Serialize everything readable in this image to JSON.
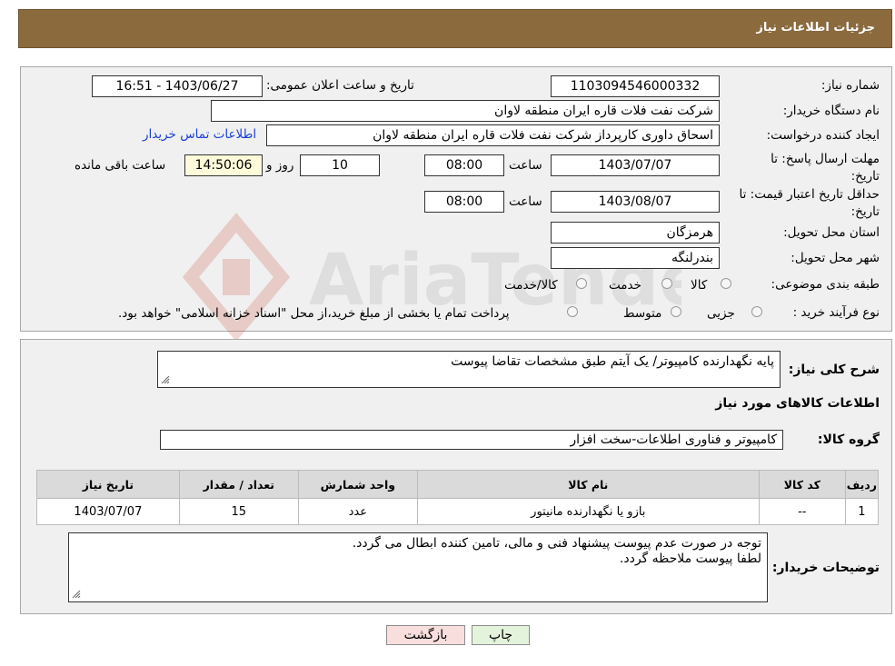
{
  "header": {
    "title": "جزئیات اطلاعات نیاز"
  },
  "form": {
    "need_number_label": "شماره نیاز:",
    "need_number": "1103094546000332",
    "announce_label": "تاریخ و ساعت اعلان عمومی:",
    "announce_value": "1403/06/27 - 16:51",
    "buyer_org_label": "نام دستگاه خریدار:",
    "buyer_org": "شرکت نفت فلات قاره ایران منطقه لاوان",
    "creator_label": "ایجاد کننده درخواست:",
    "creator": "اسحاق داوری کارپرداز شرکت نفت فلات قاره ایران منطقه لاوان",
    "contact_link": "اطلاعات تماس خریدار",
    "deadline_label": "مهلت ارسال پاسخ: تا تاریخ:",
    "deadline_date": "1403/07/07",
    "time_label": "ساعت",
    "deadline_time": "08:00",
    "days_value": "10",
    "days_label": "روز و",
    "remaining_time": "14:50:06",
    "remaining_label": "ساعت باقی مانده",
    "validity_label": "حداقل تاریخ اعتبار قیمت: تا تاریخ:",
    "validity_date": "1403/08/07",
    "validity_time": "08:00",
    "province_label": "استان محل تحویل:",
    "province": "هرمزگان",
    "city_label": "شهر محل تحویل:",
    "city": "بندرلنگه",
    "category_label": "طبقه بندی موضوعی:",
    "category_options": [
      "کالا",
      "خدمت",
      "کالا/خدمت"
    ],
    "process_label": "نوع فرآیند خرید :",
    "process_options": [
      "جزیی",
      "متوسط"
    ],
    "process_note": "پرداخت تمام یا بخشی از مبلغ خرید،از محل \"اسناد خزانه اسلامی\" خواهد بود."
  },
  "watermark": {
    "text": "AriaTender.neT"
  },
  "details": {
    "summary_label": "شرح کلی نیاز:",
    "summary": "پایه نگهدارنده کامپیوتر/ یک آیتم طبق مشخصات تقاضا پیوست",
    "goods_info_title": "اطلاعات کالاهای مورد نیاز",
    "goods_group_label": "گروه کالا:",
    "goods_group": "کامپیوتر و فناوری اطلاعات-سخت افزار",
    "table": {
      "headers": [
        "ردیف",
        "کد کالا",
        "نام کالا",
        "واحد شمارش",
        "تعداد / مقدار",
        "تاریخ نیاز"
      ],
      "rows": [
        [
          "1",
          "--",
          "بازو یا نگهدارنده مانیتور",
          "عدد",
          "15",
          "1403/07/07"
        ]
      ]
    },
    "buyer_notes_label": "توضیحات خریدار:",
    "buyer_notes_line1": "توجه در صورت عدم پیوست پیشنهاد فنی و مالی، تامین کننده ابطال می گردد.",
    "buyer_notes_line2": "لطفا پیوست ملاحظه گردد."
  },
  "buttons": {
    "print": "چاپ",
    "back": "بازگشت"
  },
  "colors": {
    "header_bg": "#8b6a3e",
    "link": "#1a3fd9",
    "back_button_bg": "#f9dede",
    "print_button_bg": "#e4f4dc"
  }
}
